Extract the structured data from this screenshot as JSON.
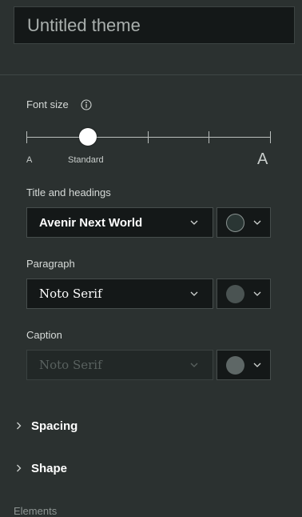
{
  "theme_name": {
    "placeholder": "Untitled theme"
  },
  "font_size": {
    "label": "Font size",
    "min_label": "A",
    "current_label": "Standard",
    "max_label": "A",
    "steps": 5,
    "selected_step": 1
  },
  "title_headings": {
    "label": "Title and headings",
    "font": "Avenir Next World",
    "color": "#2a3634"
  },
  "paragraph": {
    "label": "Paragraph",
    "font": "Noto Serif",
    "color": "#4a5352"
  },
  "caption": {
    "label": "Caption",
    "font": "Noto Serif",
    "color": "#5e6766"
  },
  "sections": {
    "spacing": "Spacing",
    "shape": "Shape",
    "elements": "Elements"
  }
}
